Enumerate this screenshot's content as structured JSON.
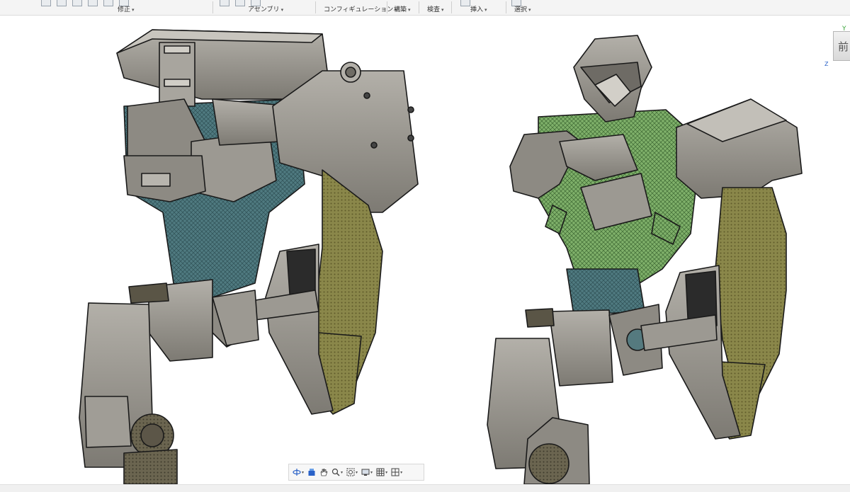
{
  "ribbon": {
    "groups": [
      {
        "label": "修正",
        "caret": "▾"
      },
      {
        "label": "アセンブリ",
        "caret": "▾"
      },
      {
        "label": "コンフィギュレーション",
        "caret": "▾"
      },
      {
        "label": "構築",
        "caret": "▾"
      },
      {
        "label": "検査",
        "caret": "▾"
      },
      {
        "label": "挿入",
        "caret": "▾"
      },
      {
        "label": "選択",
        "caret": "▾"
      }
    ]
  },
  "viewcube": {
    "face": "前",
    "axis_y": "Y",
    "axis_z": "Z"
  },
  "navbar": {
    "items": [
      {
        "icon": "orbit-icon"
      },
      {
        "icon": "look-at-icon"
      },
      {
        "icon": "pan-hand-icon"
      },
      {
        "icon": "zoom-icon"
      },
      {
        "icon": "fit-window-icon"
      },
      {
        "icon": "display-settings-icon"
      },
      {
        "icon": "grid-icon"
      },
      {
        "icon": "viewports-icon"
      }
    ],
    "caret": "▾"
  },
  "colors": {
    "armor": "#8d8a83",
    "armor_light": "#b3b0a9",
    "armor_dark": "#6e6b65",
    "teal_frame": "#4f7a80",
    "green_mesh": "#7fb06a",
    "olive_arm": "#8a874a",
    "olive_dark": "#6e6a33"
  }
}
